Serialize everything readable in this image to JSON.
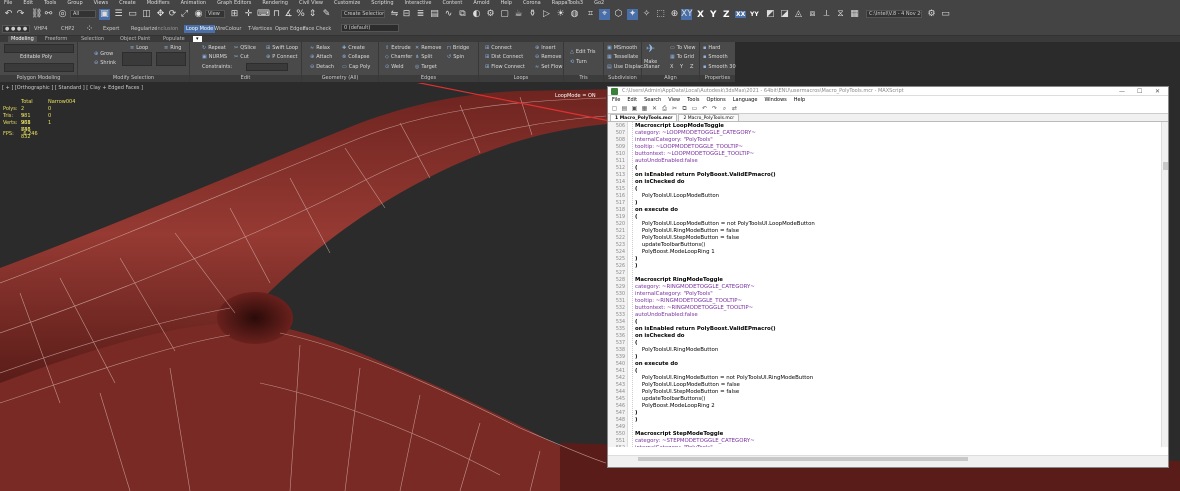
{
  "menu": [
    "File",
    "Edit",
    "Tools",
    "Group",
    "Views",
    "Create",
    "Modifiers",
    "Animation",
    "Graph Editors",
    "Rendering",
    "Civil View",
    "Customize",
    "Scripting",
    "Interactive",
    "Content",
    "Arnold",
    "Help",
    "Corona",
    "RappaTools3",
    "Go2"
  ],
  "toolbar": {
    "filter_value": "All",
    "selection_set_placeholder": "Create Selection Se",
    "layer_value": "0 (default)",
    "workspace_value": "C:\\Intel\\V.8 - 4 Nov 2020",
    "axes": [
      "XY",
      "X",
      "Y",
      "Z",
      "XX",
      "YY"
    ],
    "row2_labels": [
      "VHP4",
      "CHP2",
      "Expert",
      "Regularize",
      "Inclusion",
      "Loop Mode",
      "WireColour",
      "T-Vertices",
      "Open Edges",
      "Face Check"
    ]
  },
  "ribbon_tabs": [
    "Modeling",
    "Freeform",
    "Selection",
    "Object Paint",
    "Populate"
  ],
  "ribbon": {
    "polygon_modeling": {
      "label": "Editable Poly",
      "footer": "Polygon Modeling"
    },
    "modify_selection": {
      "items": [
        "Loop",
        "Ring",
        "Grow",
        "Shrink"
      ],
      "footer": "Modify Selection"
    },
    "edit": {
      "items": [
        "Repeat",
        "QSlice",
        "Swift Loop",
        "NURMS",
        "Cut",
        "P Connect",
        "Constraints:"
      ],
      "footer": "Edit"
    },
    "geometry": {
      "items": [
        "Relax",
        "Create",
        "Attach",
        "Collapse",
        "Detach",
        "Cap Poly"
      ],
      "footer": "Geometry (All)"
    },
    "edges": {
      "items": [
        "Extrude",
        "Remove",
        "Bridge",
        "Chamfer",
        "Split",
        "Spin",
        "Weld",
        "Target"
      ],
      "footer": "Edges"
    },
    "loops": {
      "items": [
        "Connect",
        "Insert",
        "Dist Connect",
        "Remove",
        "Flow Connect",
        "Set Flow"
      ],
      "footer": "Loops"
    },
    "tris": {
      "items": [
        "Edit Tris",
        "Turn"
      ],
      "footer": "Tris"
    },
    "subdivision": {
      "items": [
        "MSmooth",
        "Tessellate",
        "Use Displac..."
      ],
      "footer": "Subdivision"
    },
    "align": {
      "items": [
        "Make Planar",
        "To View",
        "To Grid",
        "X",
        "Y",
        "Z"
      ],
      "footer": "Align"
    },
    "properties": {
      "items": [
        "Hard",
        "Smooth",
        "Smooth 30"
      ],
      "footer": "Properties"
    }
  },
  "viewport": {
    "label": "[ + ] [Orthographic ] [ Standard ] [ Clay + Edged Faces ]",
    "stats": {
      "headers": [
        "Total",
        "Narrow004"
      ],
      "rows": [
        [
          "Polys:",
          "2 981 938",
          "0"
        ],
        [
          "Tris:",
          "5 961 846",
          "0"
        ],
        [
          "Verts:",
          "2 733 832",
          "1"
        ]
      ]
    },
    "fps_label": "FPS:",
    "fps_value": "6.246",
    "loopmode_label": "LoopMode = ON"
  },
  "editor": {
    "title": "C:\\Users\\Admin\\AppData\\Local\\Autodesk\\3dsMax\\2021 - 64bit\\ENU\\usermacros\\Macro_PolyTools.mcr - MAXScript",
    "menu": [
      "File",
      "Edit",
      "Search",
      "View",
      "Tools",
      "Options",
      "Language",
      "Windows",
      "Help"
    ],
    "tabs": [
      "1 Macro_PolyTools.mcr",
      "2 Macro_PolyTools.mcr"
    ],
    "lines": [
      {
        "n": "506",
        "t": "Macroscript LoopModeToggle",
        "s": "kw"
      },
      {
        "n": "507",
        "t": "category: ~LOOPMODETOGGLE_CATEGORY~",
        "s": "str"
      },
      {
        "n": "508",
        "t": "internalCategory: \"PolyTools\"",
        "s": "str"
      },
      {
        "n": "509",
        "t": "tooltip: ~LOOPMODETOGGLE_TOOLTIP~",
        "s": "str"
      },
      {
        "n": "510",
        "t": "buttontext: ~LOOPMODETOGGLE_TOOLTIP~",
        "s": "str"
      },
      {
        "n": "511",
        "t": "autoUndoEnabled:false",
        "s": "str"
      },
      {
        "n": "512",
        "t": "(",
        "s": "kw"
      },
      {
        "n": "513",
        "t": "on isEnabled return PolyBoost.ValidEPmacro()",
        "s": "kw"
      },
      {
        "n": "514",
        "t": "on isChecked do",
        "s": "kw"
      },
      {
        "n": "515",
        "t": "(",
        "s": "kw"
      },
      {
        "n": "516",
        "t": "    PolyToolsUI.LoopModeButton",
        "s": ""
      },
      {
        "n": "517",
        "t": ")",
        "s": "kw"
      },
      {
        "n": "518",
        "t": "on execute do",
        "s": "kw"
      },
      {
        "n": "519",
        "t": "(",
        "s": "kw"
      },
      {
        "n": "520",
        "t": "    PolyToolsUI.LoopModeButton = not PolyToolsUI.LoopModeButton",
        "s": ""
      },
      {
        "n": "521",
        "t": "    PolyToolsUI.RingModeButton = false",
        "s": ""
      },
      {
        "n": "522",
        "t": "    PolyToolsUI.StepModeButton = false",
        "s": ""
      },
      {
        "n": "523",
        "t": "    updateToolbarButtons()",
        "s": ""
      },
      {
        "n": "524",
        "t": "    PolyBoost.ModeLoopRing 1",
        "s": ""
      },
      {
        "n": "525",
        "t": ")",
        "s": "kw"
      },
      {
        "n": "526",
        "t": ")",
        "s": "kw"
      },
      {
        "n": "527",
        "t": "",
        "s": ""
      },
      {
        "n": "528",
        "t": "Macroscript RingModeToggle",
        "s": "kw"
      },
      {
        "n": "529",
        "t": "category: ~RINGMODETOGGLE_CATEGORY~",
        "s": "str"
      },
      {
        "n": "530",
        "t": "internalCategory: \"PolyTools\"",
        "s": "str"
      },
      {
        "n": "531",
        "t": "tooltip: ~RINGMODETOGGLE_TOOLTIP~",
        "s": "str"
      },
      {
        "n": "532",
        "t": "buttontext: ~RINGMODETOGGLE_TOOLTIP~",
        "s": "str"
      },
      {
        "n": "533",
        "t": "autoUndoEnabled:false",
        "s": "str"
      },
      {
        "n": "534",
        "t": "(",
        "s": "kw"
      },
      {
        "n": "535",
        "t": "on isEnabled return PolyBoost.ValidEPmacro()",
        "s": "kw"
      },
      {
        "n": "536",
        "t": "on isChecked do",
        "s": "kw"
      },
      {
        "n": "537",
        "t": "(",
        "s": "kw"
      },
      {
        "n": "538",
        "t": "    PolyToolsUI.RingModeButton",
        "s": ""
      },
      {
        "n": "539",
        "t": ")",
        "s": "kw"
      },
      {
        "n": "540",
        "t": "on execute do",
        "s": "kw"
      },
      {
        "n": "541",
        "t": "(",
        "s": "kw"
      },
      {
        "n": "542",
        "t": "    PolyToolsUI.RingModeButton = not PolyToolsUI.RingModeButton",
        "s": ""
      },
      {
        "n": "543",
        "t": "    PolyToolsUI.LoopModeButton = false",
        "s": ""
      },
      {
        "n": "544",
        "t": "    PolyToolsUI.StepModeButton = false",
        "s": ""
      },
      {
        "n": "545",
        "t": "    updateToolbarButtons()",
        "s": ""
      },
      {
        "n": "546",
        "t": "    PolyBoost.ModeLoopRing 2",
        "s": ""
      },
      {
        "n": "547",
        "t": ")",
        "s": "kw"
      },
      {
        "n": "548",
        "t": ")",
        "s": "kw"
      },
      {
        "n": "549",
        "t": "",
        "s": ""
      },
      {
        "n": "550",
        "t": "Macroscript StepModeToggle",
        "s": "kw"
      },
      {
        "n": "551",
        "t": "category: ~STEPMODETOGGLE_CATEGORY~",
        "s": "str"
      },
      {
        "n": "552",
        "t": "internalCategory: \"PolyTools\"",
        "s": "str"
      },
      {
        "n": "553",
        "t": "tooltip: ~STEPMODETOGGLE_TOOLTIP~",
        "s": "str"
      }
    ]
  },
  "colors": {
    "mesh": "#8a2f2a",
    "mesh_dark": "#5a1a17",
    "accent": "#4a6fa8",
    "arrow": "#e03030",
    "stats": "#e8e060"
  }
}
